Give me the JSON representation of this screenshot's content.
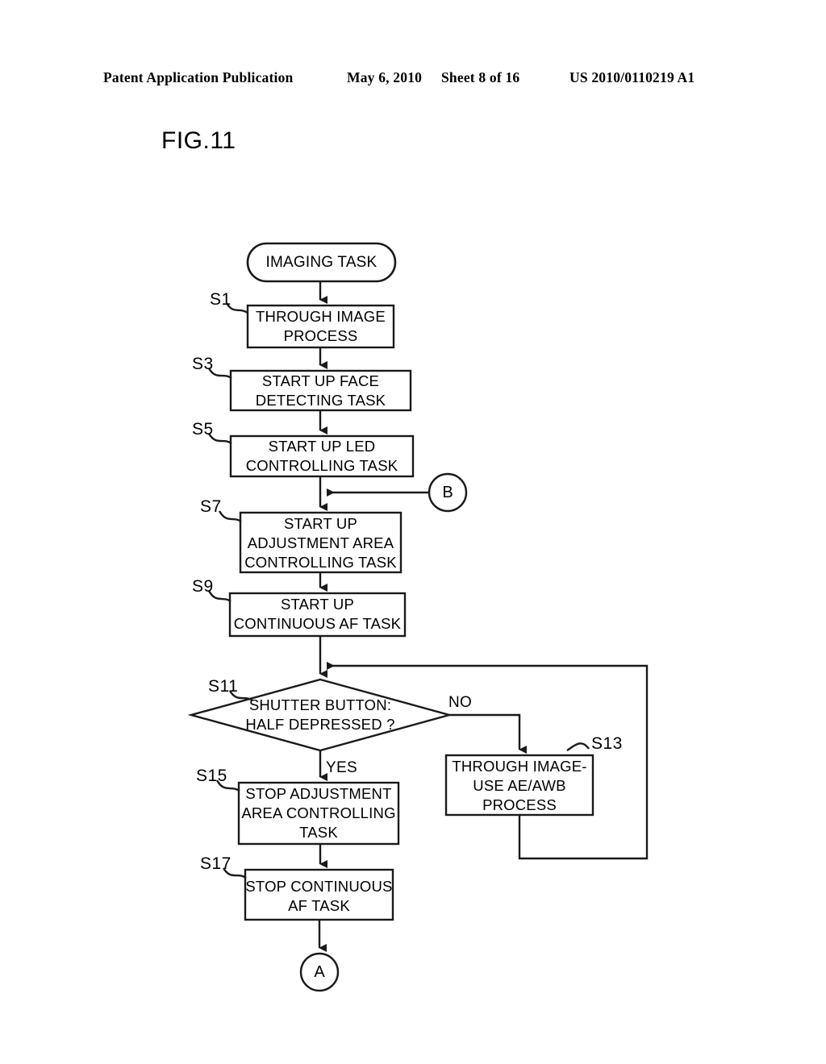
{
  "header": {
    "publication": "Patent Application Publication",
    "date": "May 6, 2010",
    "sheet": "Sheet 8 of 16",
    "patent_number": "US 2010/0110219 A1"
  },
  "figure": {
    "title": "FIG.11"
  },
  "flowchart": {
    "start_node": {
      "label": "IMAGING TASK",
      "shape": "stadium"
    },
    "steps": [
      {
        "tag": "S1",
        "label": "THROUGH IMAGE\nPROCESS",
        "shape": "process"
      },
      {
        "tag": "S3",
        "label": "START UP FACE\nDETECTING TASK",
        "shape": "process"
      },
      {
        "tag": "S5",
        "label": "START UP LED\nCONTROLLING TASK",
        "shape": "process"
      },
      {
        "tag": "S7",
        "label": "START UP\nADJUSTMENT AREA\nCONTROLLING TASK",
        "shape": "process"
      },
      {
        "tag": "S9",
        "label": "START UP\nCONTINUOUS AF TASK",
        "shape": "process"
      },
      {
        "tag": "S11",
        "label": "SHUTTER BUTTON:\nHALF DEPRESSED ?",
        "shape": "decision"
      },
      {
        "tag": "S13",
        "label": "THROUGH IMAGE-\nUSE AE/AWB\nPROCESS",
        "shape": "process"
      },
      {
        "tag": "S15",
        "label": "STOP ADJUSTMENT\nAREA CONTROLLING\nTASK",
        "shape": "process"
      },
      {
        "tag": "S17",
        "label": "STOP CONTINUOUS\nAF TASK",
        "shape": "process"
      }
    ],
    "branch_labels": {
      "no": "NO",
      "yes": "YES"
    },
    "connectors": [
      {
        "id": "B",
        "label": "B",
        "role": "entry"
      },
      {
        "id": "A",
        "label": "A",
        "role": "exit"
      }
    ],
    "colors": {
      "stroke": "#000000",
      "fill": "#ffffff",
      "background": "#ffffff"
    }
  }
}
